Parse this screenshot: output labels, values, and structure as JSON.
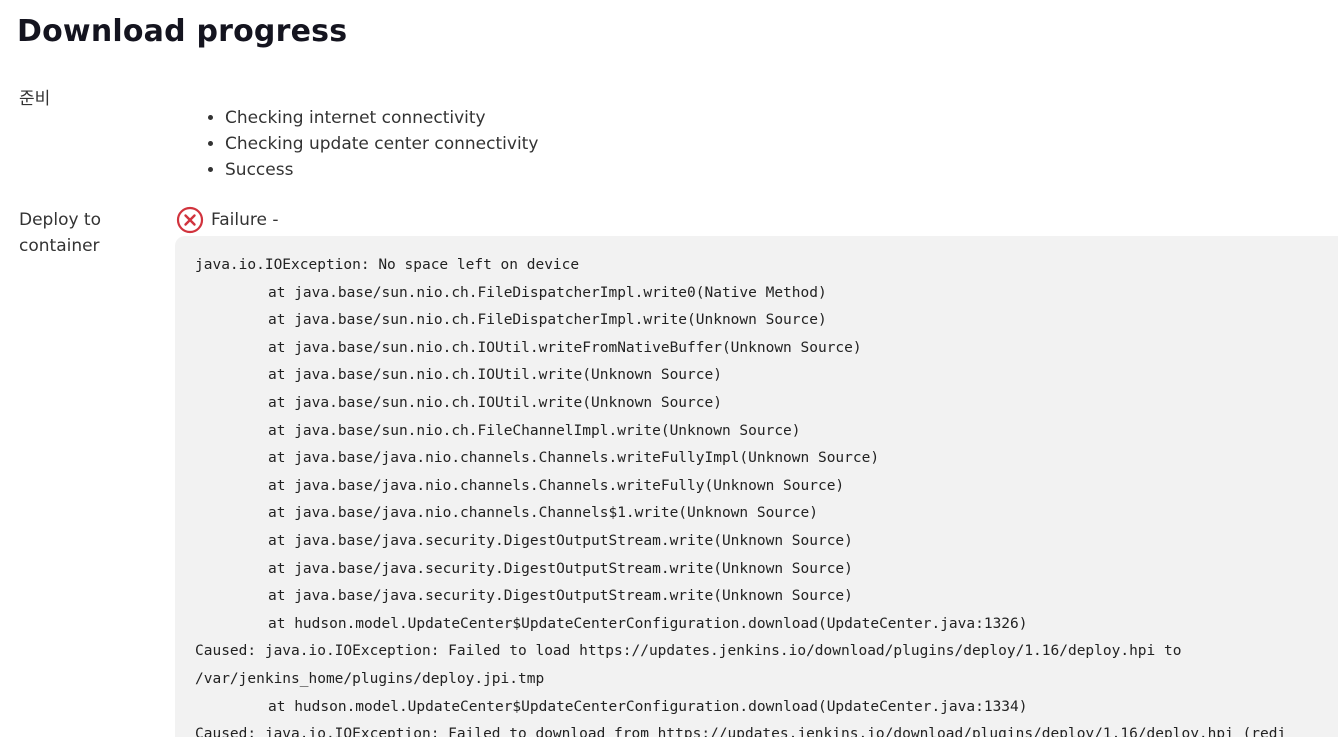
{
  "page": {
    "title": "Download progress"
  },
  "sections": {
    "prep": {
      "label": "준비",
      "items": [
        "Checking internet connectivity",
        "Checking update center connectivity",
        "Success"
      ]
    },
    "deploy": {
      "label": "Deploy to container",
      "status_icon": "error-circle-x-icon",
      "status_text": "Failure -",
      "status_color": "#d1333d",
      "log": [
        {
          "text": "java.io.IOException: No space left on device",
          "indent": false
        },
        {
          "text": "at java.base/sun.nio.ch.FileDispatcherImpl.write0(Native Method)",
          "indent": true
        },
        {
          "text": "at java.base/sun.nio.ch.FileDispatcherImpl.write(Unknown Source)",
          "indent": true
        },
        {
          "text": "at java.base/sun.nio.ch.IOUtil.writeFromNativeBuffer(Unknown Source)",
          "indent": true
        },
        {
          "text": "at java.base/sun.nio.ch.IOUtil.write(Unknown Source)",
          "indent": true
        },
        {
          "text": "at java.base/sun.nio.ch.IOUtil.write(Unknown Source)",
          "indent": true
        },
        {
          "text": "at java.base/sun.nio.ch.FileChannelImpl.write(Unknown Source)",
          "indent": true
        },
        {
          "text": "at java.base/java.nio.channels.Channels.writeFullyImpl(Unknown Source)",
          "indent": true
        },
        {
          "text": "at java.base/java.nio.channels.Channels.writeFully(Unknown Source)",
          "indent": true
        },
        {
          "text": "at java.base/java.nio.channels.Channels$1.write(Unknown Source)",
          "indent": true
        },
        {
          "text": "at java.base/java.security.DigestOutputStream.write(Unknown Source)",
          "indent": true
        },
        {
          "text": "at java.base/java.security.DigestOutputStream.write(Unknown Source)",
          "indent": true
        },
        {
          "text": "at java.base/java.security.DigestOutputStream.write(Unknown Source)",
          "indent": true
        },
        {
          "text": "at hudson.model.UpdateCenter$UpdateCenterConfiguration.download(UpdateCenter.java:1326)",
          "indent": true
        },
        {
          "text": "Caused: java.io.IOException: Failed to load https://updates.jenkins.io/download/plugins/deploy/1.16/deploy.hpi to",
          "indent": false
        },
        {
          "text": "/var/jenkins_home/plugins/deploy.jpi.tmp",
          "indent": false
        },
        {
          "text": "at hudson.model.UpdateCenter$UpdateCenterConfiguration.download(UpdateCenter.java:1334)",
          "indent": true
        },
        {
          "text": "Caused: java.io.IOException: Failed to download from https://updates.jenkins.io/download/plugins/deploy/1.16/deploy.hpi (redi",
          "indent": false
        }
      ]
    }
  }
}
